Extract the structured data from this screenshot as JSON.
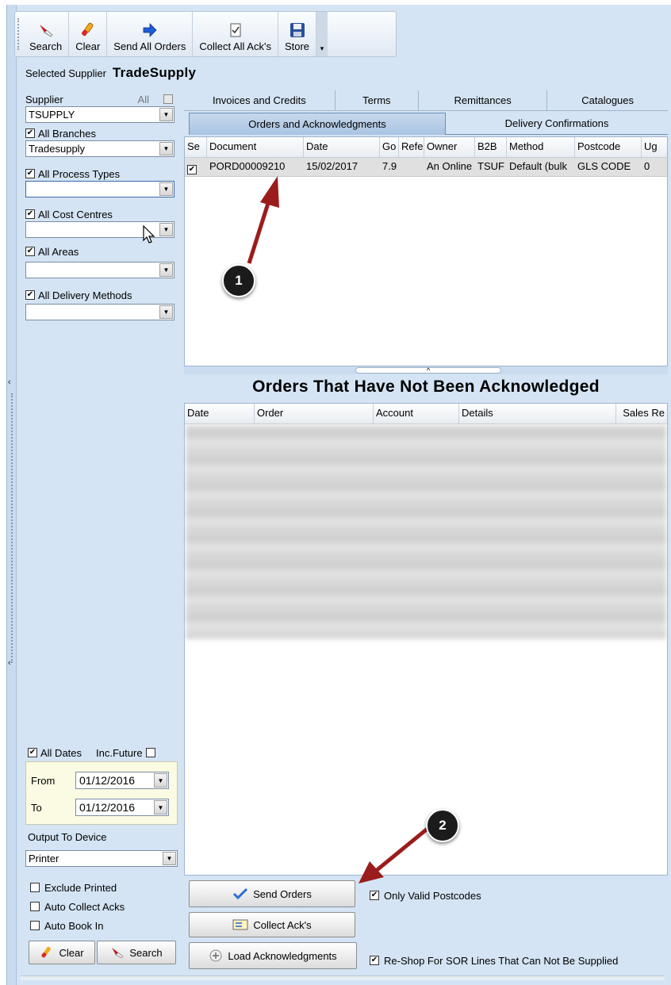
{
  "toolbar": {
    "search": "Search",
    "clear": "Clear",
    "send_all_orders": "Send All Orders",
    "collect_all_acks": "Collect All Ack's",
    "store": "Store"
  },
  "selected_supplier": {
    "label": "Selected Supplier",
    "value": "TradeSupply"
  },
  "filters": {
    "supplier_label": "Supplier",
    "all_label": "All",
    "supplier_value": "TSUPPLY",
    "all_branches": "All Branches",
    "branch_value": "Tradesupply",
    "all_process_types": "All Process Types",
    "all_cost_centres": "All Cost Centres",
    "all_areas": "All Areas",
    "all_delivery_methods": "All Delivery Methods"
  },
  "dates": {
    "all_dates": "All Dates",
    "inc_future": "Inc.Future",
    "from_label": "From",
    "from_value": "01/12/2016",
    "to_label": "To",
    "to_value": "01/12/2016"
  },
  "output": {
    "label": "Output To Device",
    "value": "Printer"
  },
  "options": {
    "exclude_printed": "Exclude Printed",
    "auto_collect_acks": "Auto Collect Acks",
    "auto_book_in": "Auto Book In"
  },
  "left_buttons": {
    "clear": "Clear",
    "search": "Search"
  },
  "tabs_row1": [
    "Invoices and Credits",
    "Terms",
    "Remittances",
    "Catalogues"
  ],
  "tabs_row2": [
    "Orders and Acknowledgments",
    "Delivery Confirmations"
  ],
  "orders_grid": {
    "headers": [
      "Se",
      "Document",
      "Date",
      "Go",
      "Refe",
      "Owner",
      "B2B",
      "Method",
      "Postcode",
      "Ug"
    ],
    "row": [
      "PORD00009210",
      "15/02/2017",
      "7.9",
      "",
      "An Online",
      "TSUF",
      "Default (bulk",
      "GLS CODE",
      "0"
    ]
  },
  "unack": {
    "title": "Orders That Have Not Been Acknowledged",
    "headers": [
      "Date",
      "Order",
      "Account",
      "Details",
      "Sales Re"
    ]
  },
  "actions": {
    "send_orders": "Send Orders",
    "collect_acks": "Collect Ack's",
    "load_acks": "Load Acknowledgments",
    "only_valid_postcodes": "Only Valid Postcodes",
    "reshop": "Re-Shop For SOR Lines That Can Not Be Supplied"
  },
  "annotations": {
    "badge1": "1",
    "badge2": "2"
  },
  "colors": {
    "panel": "#d4e4f4",
    "active_tab": "#a9c4e2",
    "arrow": "#9b1c1c"
  }
}
